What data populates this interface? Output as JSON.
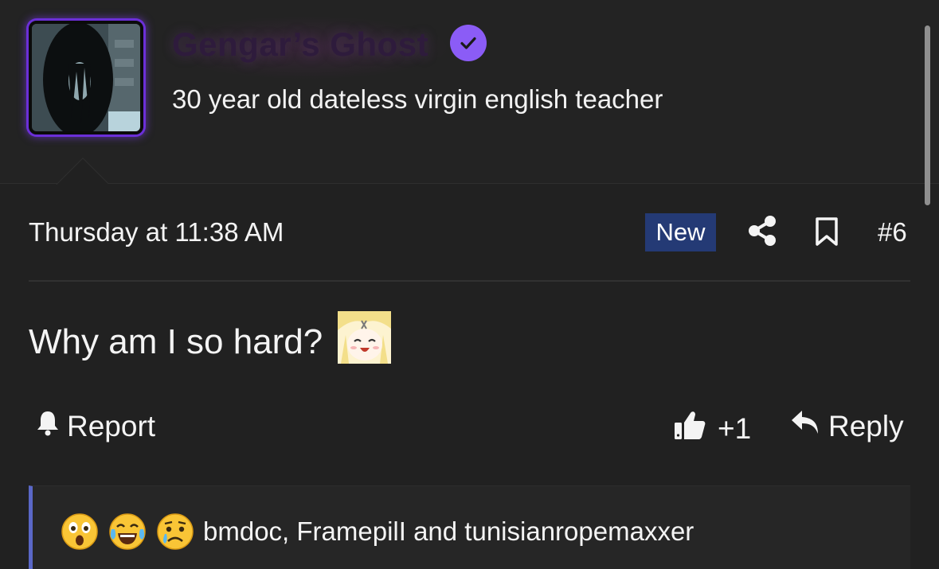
{
  "user": {
    "name": "Gengar’s Ghost",
    "title": "30 year old dateless virgin english teacher",
    "verified": true,
    "avatar_border_color": "#6b2fd8"
  },
  "post": {
    "date": "Thursday at 11:38 AM",
    "new_badge": "New",
    "number": "#6",
    "body": "Why am I so hard?",
    "inline_emoji": "anime-laughing-emoji"
  },
  "actions": {
    "report_label": "Report",
    "like_count": "+1",
    "reply_label": "Reply"
  },
  "reactions": {
    "emojis": [
      "astonished-face",
      "face-with-tears-of-joy",
      "sad-but-relieved-face"
    ],
    "users_text": "bmdoc, FramepilI and tunisianropemaxxer"
  },
  "colors": {
    "background": "#212121",
    "badge": "#243a75",
    "verified": "#8b5cf6",
    "reaction_accent": "#5a67c7"
  }
}
